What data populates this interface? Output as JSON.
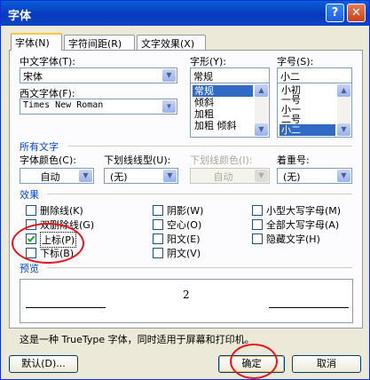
{
  "window": {
    "title": "字体",
    "help_glyph": "?",
    "close_glyph": "✕"
  },
  "tabs": [
    {
      "label": "字体(N)"
    },
    {
      "label": "字符间距(R)"
    },
    {
      "label": "文字效果(X)"
    }
  ],
  "font": {
    "chinese_label": "中文字体(T):",
    "chinese_value": "宋体",
    "western_label": "西文字体(F):",
    "western_value": "Times New Roman",
    "style_label": "字形(Y):",
    "style_value": "常规",
    "style_options": [
      "常规",
      "倾斜",
      "加粗",
      "加粗 倾斜"
    ],
    "size_label": "字号(S):",
    "size_value": "小二",
    "size_options": [
      "小初",
      "一号",
      "小一",
      "二号",
      "小二"
    ]
  },
  "all_text": {
    "section_label": "所有文字",
    "color_label": "字体颜色(C):",
    "color_value": "自动",
    "underline_type_label": "下划线线型(U):",
    "underline_type_value": "(无)",
    "underline_color_label": "下划线颜色(I):",
    "underline_color_value": "自动",
    "emphasis_label": "着重号:",
    "emphasis_value": "(无)"
  },
  "effects": {
    "section_label": "效果",
    "items": [
      {
        "label": "删除线(K)",
        "checked": false
      },
      {
        "label": "双删除线(G)",
        "checked": false
      },
      {
        "label": "上标(P)",
        "checked": true
      },
      {
        "label": "下标(B)",
        "checked": false
      },
      {
        "label": "阴影(W)",
        "checked": false
      },
      {
        "label": "空心(O)",
        "checked": false
      },
      {
        "label": "阳文(E)",
        "checked": false
      },
      {
        "label": "阴文(V)",
        "checked": false
      },
      {
        "label": "小型大写字母(M)",
        "checked": false
      },
      {
        "label": "全部大写字母(A)",
        "checked": false
      },
      {
        "label": "隐藏文字(H)",
        "checked": false
      }
    ]
  },
  "preview": {
    "section_label": "预览",
    "sample": "2"
  },
  "description": "这是一种 TrueType 字体，同时适用于屏幕和打印机。",
  "buttons": {
    "default": "默认(D)...",
    "ok": "确定",
    "cancel": "取消"
  },
  "colors": {
    "title_bar": "#0839bd",
    "accent": "#0046d5",
    "highlight": "#316ac5",
    "annotation": "#e8141c"
  }
}
